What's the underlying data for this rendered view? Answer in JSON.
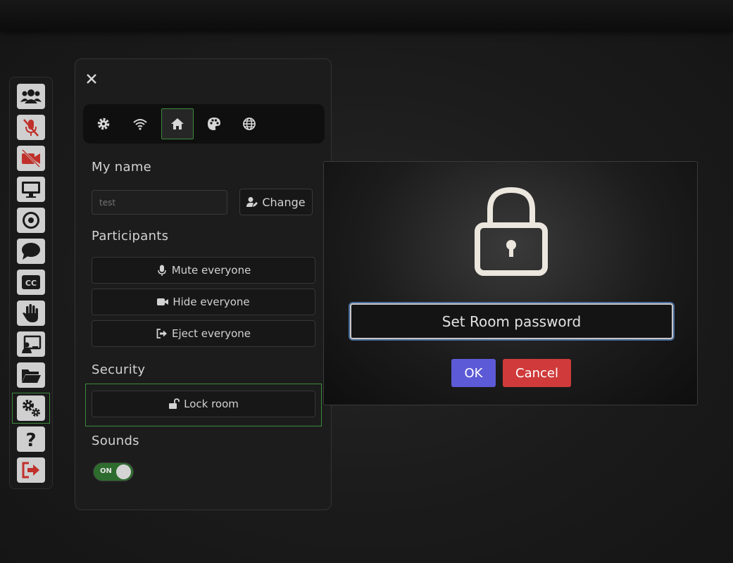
{
  "colors": {
    "accent_green": "#3c8a3c",
    "ok_button": "#5c5ad6",
    "cancel_button": "#d03a3a",
    "leave_icon": "#c0302b",
    "toolbar_button": "#cfcfcf"
  },
  "toolbar": {
    "items": [
      {
        "icon": "participants-icon"
      },
      {
        "icon": "microphone-muted-icon"
      },
      {
        "icon": "video-off-icon"
      },
      {
        "icon": "screen-share-icon"
      },
      {
        "icon": "record-icon"
      },
      {
        "icon": "chat-icon"
      },
      {
        "icon": "captions-icon"
      },
      {
        "icon": "raise-hand-icon"
      },
      {
        "icon": "whiteboard-icon"
      },
      {
        "icon": "file-sharing-icon"
      },
      {
        "icon": "settings-icon",
        "active": true
      },
      {
        "icon": "help-icon"
      },
      {
        "icon": "leave-room-icon"
      }
    ]
  },
  "settings": {
    "tabs": [
      {
        "icon": "gear-icon"
      },
      {
        "icon": "wifi-icon"
      },
      {
        "icon": "home-icon",
        "active": true
      },
      {
        "icon": "palette-icon"
      },
      {
        "icon": "globe-icon"
      }
    ],
    "my_name_label": "My name",
    "name_value": "test",
    "change_label": "Change",
    "participants_label": "Participants",
    "mute_everyone": "Mute everyone",
    "hide_everyone": "Hide everyone",
    "eject_everyone": "Eject everyone",
    "security_label": "Security",
    "lock_room": "Lock room",
    "sounds_label": "Sounds",
    "sounds_toggle": "ON"
  },
  "dialog": {
    "icon": "lock-icon",
    "password_placeholder": "Set Room password",
    "ok_label": "OK",
    "cancel_label": "Cancel"
  }
}
